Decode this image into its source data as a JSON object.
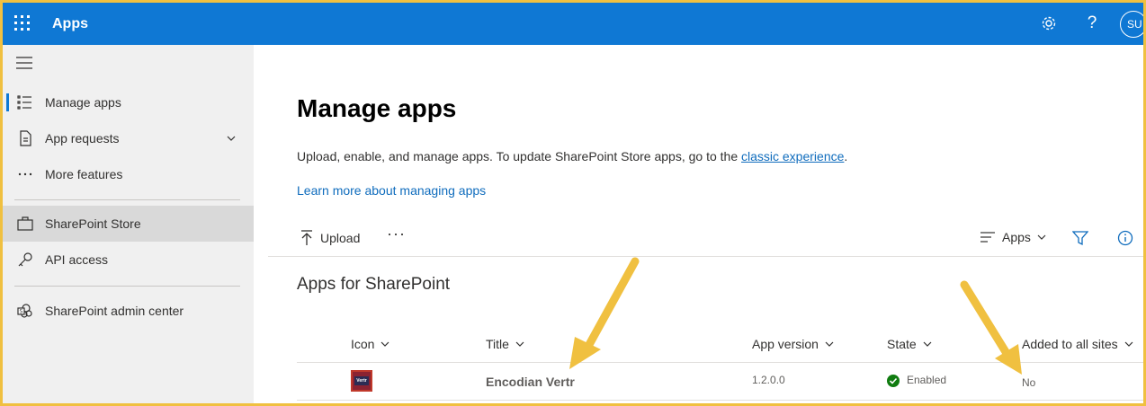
{
  "topbar": {
    "title": "Apps",
    "avatar_initials": "SU",
    "help_glyph": "?"
  },
  "sidebar": {
    "items": [
      {
        "label": "Manage apps",
        "icon": "list-icon"
      },
      {
        "label": "App requests",
        "icon": "document-icon"
      },
      {
        "label": "More features",
        "icon": "ellipsis-icon"
      },
      {
        "label": "SharePoint Store",
        "icon": "shopping-bag-icon"
      },
      {
        "label": "API access",
        "icon": "key-icon"
      },
      {
        "label": "SharePoint admin center",
        "icon": "sharepoint-icon"
      }
    ]
  },
  "main": {
    "title": "Manage apps",
    "description": "Upload, enable, and manage apps. To update SharePoint Store apps, go to the ",
    "description_link": "classic experience",
    "description_end": ".",
    "learn_more": "Learn more about managing apps",
    "toolbar": {
      "upload_label": "Upload",
      "more_label": "···",
      "view_label": "Apps"
    },
    "section_title": "Apps for SharePoint",
    "table": {
      "columns": [
        "Icon",
        "Title",
        "App version",
        "State",
        "Added to all sites"
      ],
      "rows": [
        {
          "icon_text": "Vertr",
          "title": "Encodian Vertr",
          "version": "1.2.0.0",
          "state": "Enabled",
          "added": "No"
        }
      ]
    }
  },
  "colors": {
    "brand": "#0f78d4",
    "enabled": "#107c10",
    "annotation_arrow": "#f0c040"
  }
}
